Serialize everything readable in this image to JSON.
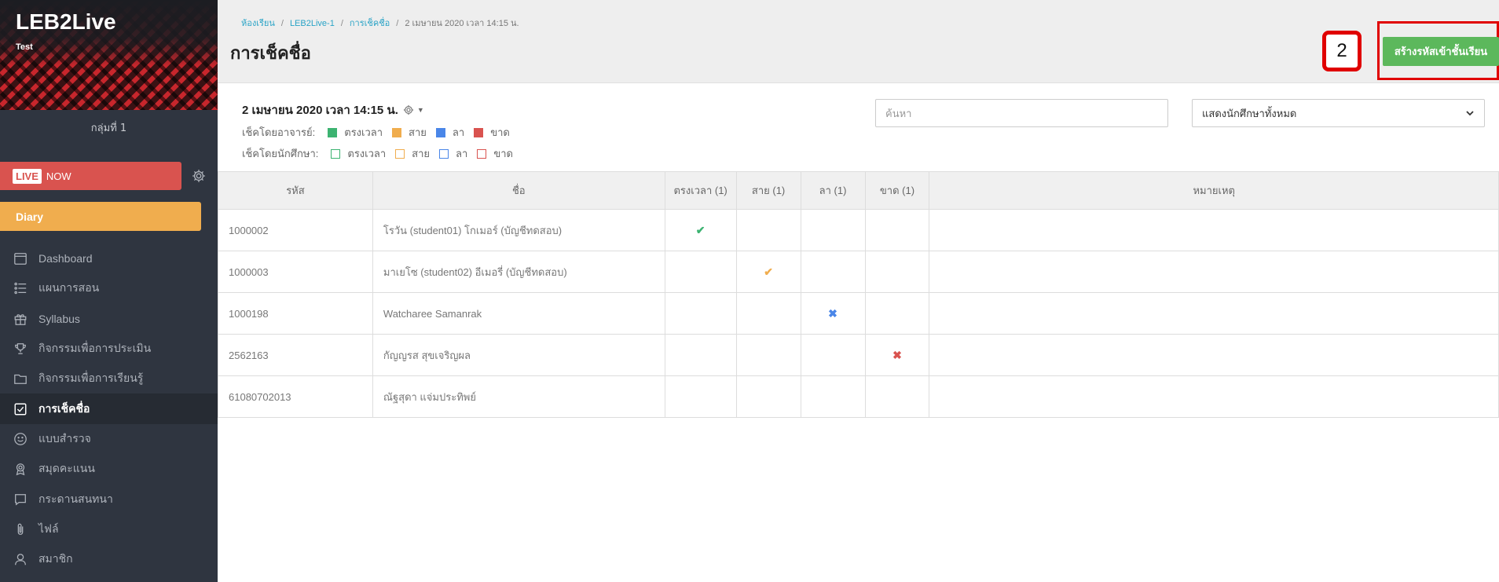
{
  "sidebar": {
    "brand_title": "LEB2Live",
    "brand_sub": "Test",
    "group": "กลุ่มที่ 1",
    "live_tag": "LIVE",
    "live_now": "NOW",
    "diary": "Diary",
    "items": [
      {
        "label": "Dashboard",
        "icon": "calendar-icon"
      },
      {
        "label": "แผนการสอน",
        "icon": "list-icon"
      },
      {
        "label": "Syllabus",
        "icon": "gift-icon"
      },
      {
        "label": "กิจกรรมเพื่อการประเมิน",
        "icon": "trophy-icon"
      },
      {
        "label": "กิจกรรมเพื่อการเรียนรู้",
        "icon": "folder-icon"
      },
      {
        "label": "การเช็คชื่อ",
        "icon": "checkbox-icon"
      },
      {
        "label": "แบบสำรวจ",
        "icon": "smile-icon"
      },
      {
        "label": "สมุดคะแนน",
        "icon": "award-icon"
      },
      {
        "label": "กระดานสนทนา",
        "icon": "chat-icon"
      },
      {
        "label": "ไฟล์",
        "icon": "paperclip-icon"
      },
      {
        "label": "สมาชิก",
        "icon": "user-icon"
      }
    ]
  },
  "header": {
    "breadcrumb": [
      "ห้องเรียน",
      "LEB2Live-1",
      "การเช็คชื่อ",
      "2 เมษายน 2020 เวลา 14:15 น."
    ],
    "title": "การเช็คชื่อ",
    "step_badge": "2",
    "create_button": "สร้างรหัสเข้าชั้นเรียน"
  },
  "info": {
    "date": "2 เมษายน 2020 เวลา 14:15 น.",
    "teacher_label": "เช็คโดยอาจารย์:",
    "student_label": "เช็คโดยนักศึกษา:",
    "legend": [
      {
        "label": "ตรงเวลา",
        "color": "#3cb371"
      },
      {
        "label": "สาย",
        "color": "#f0ad4e"
      },
      {
        "label": "ลา",
        "color": "#4a86e8"
      },
      {
        "label": "ขาด",
        "color": "#d9534f"
      }
    ]
  },
  "search": {
    "placeholder": "ค้นหา"
  },
  "filter": {
    "selected": "แสดงนักศึกษาทั้งหมด"
  },
  "table": {
    "headers": [
      "รหัส",
      "ชื่อ",
      "ตรงเวลา (1)",
      "สาย (1)",
      "ลา (1)",
      "ขาด (1)",
      "หมายเหตุ"
    ],
    "rows": [
      {
        "code": "1000002",
        "name": "โรวัน (student01) โกเมอร์ (บัญชีทดสอบ)",
        "status": "ontime"
      },
      {
        "code": "1000003",
        "name": "มาเยโซ (student02) อีเมอรี่ (บัญชีทดสอบ)",
        "status": "late"
      },
      {
        "code": "1000198",
        "name": "Watcharee Samanrak",
        "status": "leave"
      },
      {
        "code": "2562163",
        "name": "กัญญรส สุขเจริญผล",
        "status": "absent"
      },
      {
        "code": "61080702013",
        "name": "ณัฐสุดา แจ่มประทิพย์",
        "status": "none"
      }
    ]
  }
}
